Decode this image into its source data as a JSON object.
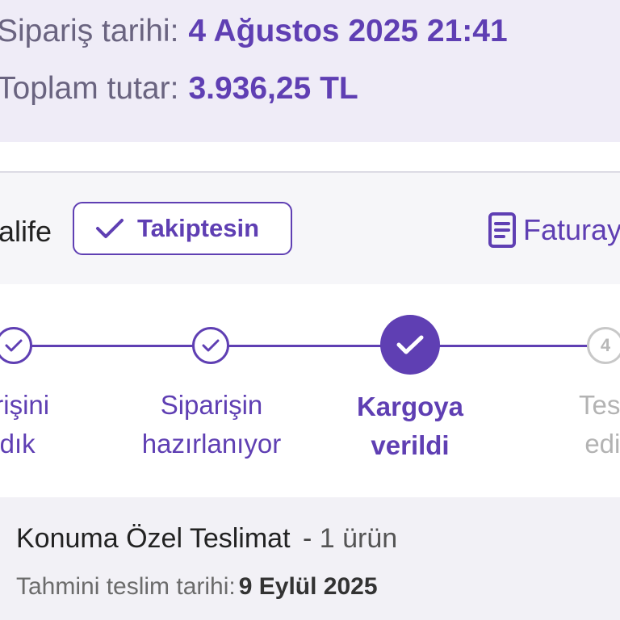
{
  "summary": {
    "order_date_label": "Sipariş tarihi:",
    "order_date_value": "4 Ağustos 2025 21:41",
    "total_label": "Toplam tutar:",
    "total_value": "3.936,25 TL"
  },
  "seller": {
    "name": "alife",
    "follow_label": "Takiptesin",
    "invoice_label": "Faturay"
  },
  "steps": [
    {
      "label": "arişini\nldık",
      "state": "done"
    },
    {
      "label": "Siparişin\nhazırlanıyor",
      "state": "done"
    },
    {
      "label": "Kargoya\nverildi",
      "state": "current"
    },
    {
      "label": "Tesli\nedil",
      "state": "pending",
      "number": "4"
    }
  ],
  "delivery": {
    "title": "Konuma Özel Teslimat",
    "separator": "-",
    "count": "1 ürün",
    "estimate_label": "Tahmini teslim tarihi:",
    "estimate_value": "9 Eylül 2025"
  },
  "colors": {
    "accent": "#5f3fb3",
    "summary_bg": "#efecf7",
    "pending": "#c8c8c8"
  },
  "icons": {
    "follow": "check-icon",
    "invoice": "document-icon",
    "step_done": "check-circle-icon",
    "step_current": "check-filled-icon"
  }
}
